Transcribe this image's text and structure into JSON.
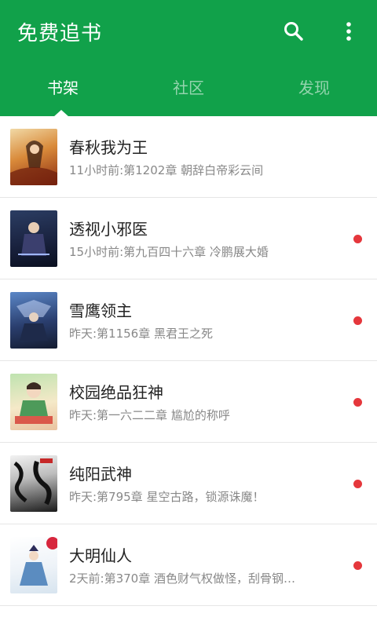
{
  "header": {
    "title": "免费追书",
    "search_icon": "search-icon",
    "more_icon": "more-vertical-icon",
    "color": "#11a14a"
  },
  "tabs": [
    {
      "label": "书架",
      "active": true
    },
    {
      "label": "社区",
      "active": false
    },
    {
      "label": "发现",
      "active": false
    }
  ],
  "books": [
    {
      "title": "春秋我为王",
      "update": "11小时前:第1202章 朝辞白帝彩云间",
      "unread": false
    },
    {
      "title": "透视小邪医",
      "update": "15小时前:第九百四十六章 冷鹏展大婚",
      "unread": true
    },
    {
      "title": "雪鹰领主",
      "update": "昨天:第1156章 黑君王之死",
      "unread": true
    },
    {
      "title": "校园绝品狂神",
      "update": "昨天:第一六二二章 尴尬的称呼",
      "unread": true
    },
    {
      "title": "纯阳武神",
      "update": "昨天:第795章 星空古路，锁源诛魔！",
      "unread": true
    },
    {
      "title": "大明仙人",
      "update": "2天前:第370章 酒色财气权做怪，刮骨钢…",
      "unread": true
    }
  ],
  "unread_dot_color": "#e5373c"
}
